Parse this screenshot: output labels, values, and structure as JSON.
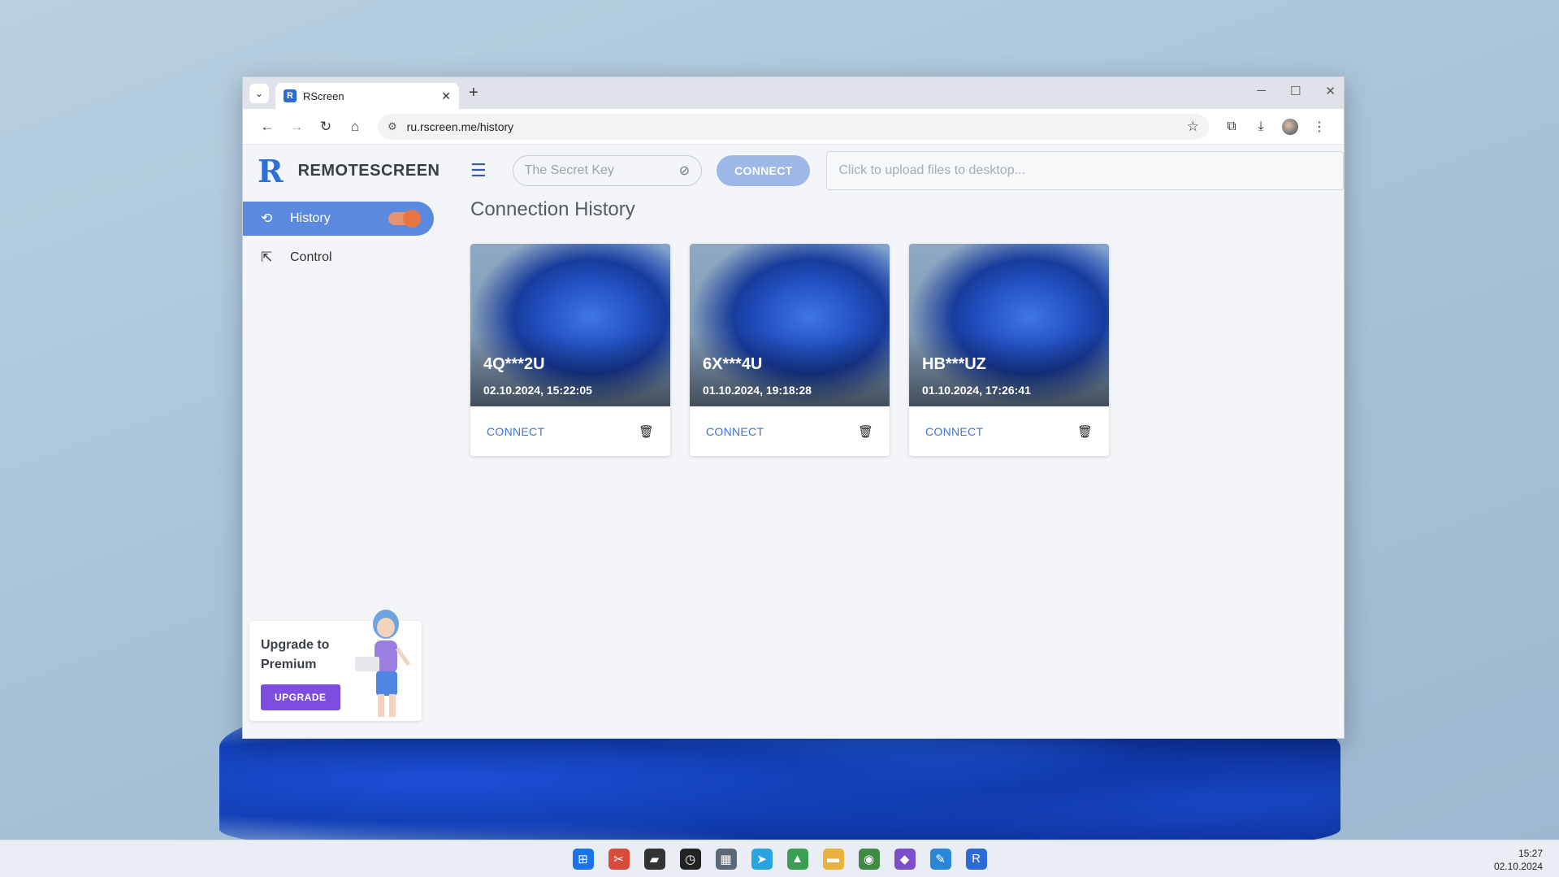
{
  "browser": {
    "tab_title": "RScreen",
    "tab_favicon": "R",
    "tab_dropdown_icon": "⌄",
    "tab_close": "✕",
    "new_tab": "+",
    "window_controls": {
      "minimize": "─",
      "maximize": "☐",
      "close": "✕"
    },
    "url": "ru.rscreen.me/history",
    "nav": {
      "back": "←",
      "forward": "→",
      "reload": "↻",
      "home": "⌂",
      "site_info": "⚙"
    },
    "tools": {
      "bookmark": "☆",
      "extensions": "⧉",
      "download": "⤓",
      "menu": "⋮"
    }
  },
  "sidebar": {
    "logo": "R",
    "brand": "REMOTESCREEN",
    "items": [
      {
        "label": "History",
        "icon": "⟲",
        "active": true
      },
      {
        "label": "Control",
        "icon": "⇱",
        "active": false
      }
    ],
    "upgrade": {
      "title": "Upgrade to Premium",
      "button": "UPGRADE"
    }
  },
  "topbar": {
    "menu_icon": "☰",
    "secret_placeholder": "The Secret Key",
    "eye_icon": "⊘",
    "connect_label": "CONNECT",
    "upload_placeholder": "Click to upload files to desktop..."
  },
  "main": {
    "title": "Connection History",
    "cards": [
      {
        "id": "4Q***2U",
        "date": "02.10.2024, 15:22:05",
        "connect": "CONNECT",
        "trash_icon": "🗑"
      },
      {
        "id": "6X***4U",
        "date": "01.10.2024, 19:18:28",
        "connect": "CONNECT",
        "trash_icon": "🗑"
      },
      {
        "id": "HB***UZ",
        "date": "01.10.2024, 17:26:41",
        "connect": "CONNECT",
        "trash_icon": "🗑"
      }
    ]
  },
  "taskbar": {
    "icons": [
      {
        "name": "windows-start",
        "glyph": "⊞",
        "color": "#1a73e8"
      },
      {
        "name": "snipping-tool",
        "glyph": "✂",
        "color": "#d84a3a"
      },
      {
        "name": "sticky-notes",
        "glyph": "▰",
        "color": "#333333"
      },
      {
        "name": "clock",
        "glyph": "◷",
        "color": "#222222"
      },
      {
        "name": "calculator",
        "glyph": "▦",
        "color": "#5a6878"
      },
      {
        "name": "telegram",
        "glyph": "➤",
        "color": "#2aa3df"
      },
      {
        "name": "photos",
        "glyph": "▲",
        "color": "#3b9e55"
      },
      {
        "name": "file-explorer",
        "glyph": "▬",
        "color": "#e8b23c"
      },
      {
        "name": "chrome",
        "glyph": "◉",
        "color": "#3d8b45"
      },
      {
        "name": "visual-studio",
        "glyph": "◆",
        "color": "#7b4fc9"
      },
      {
        "name": "paint",
        "glyph": "✎",
        "color": "#2b86d6"
      },
      {
        "name": "rscreen",
        "glyph": "R",
        "color": "#2c6bd6"
      }
    ],
    "time": "15:27",
    "date": "02.10.2024"
  }
}
